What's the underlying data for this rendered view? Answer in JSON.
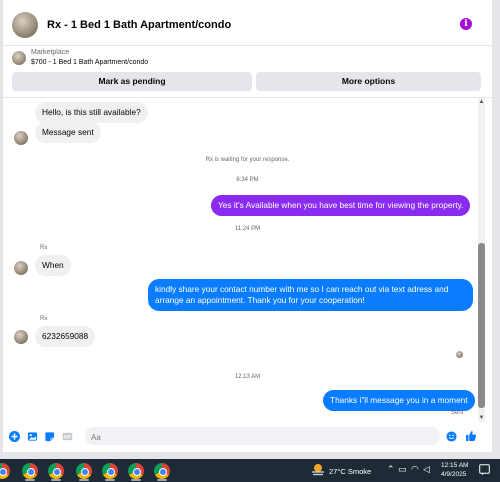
{
  "header": {
    "title": "Rx - 1 Bed 1 Bath Apartment/condo",
    "info_icon": "info-icon",
    "accent": "#a20dd9"
  },
  "marketplace": {
    "label": "Marketplace",
    "listing": "$700 - 1 Bed 1 Bath Apartment/condo",
    "mark_pending_label": "Mark as pending",
    "more_options_label": "More options"
  },
  "messages": {
    "m1": "Hello, is this still available?",
    "m2": "Message sent",
    "waiting": "Rx is waiting for your response.",
    "ts1": "6:34 PM",
    "m3": "Yes it's Available when you have best time for viewing the property.",
    "ts2": "11:24 PM",
    "sender1": "Rx",
    "m4": "When",
    "m5_line1": "kindly share your contact number with me so I can reach out via text adress and",
    "m5_line2": "arrange an appointment. Thank you for your cooperation!",
    "sender2": "Rx",
    "m6": "6232659088",
    "ts3": "12:13 AM",
    "m7": "Thanks i\"ll message you in a moment",
    "status": "Sent"
  },
  "composer": {
    "placeholder": "Aa",
    "icons": [
      "plus-icon",
      "image-icon",
      "sticker-icon",
      "gif-icon",
      "emoji-icon",
      "thumbs-up-icon"
    ]
  },
  "colors": {
    "outgoing": "#0a7cff",
    "outgoing_purple": "#8a2bf2",
    "incoming": "#f0f0f0",
    "taskbar": "#1e2a35"
  },
  "taskbar": {
    "weather": "27°C  Smoke",
    "time": "12:15 AM",
    "date": "4/9/2025",
    "app_icons": [
      "chrome-icon",
      "chrome-icon",
      "chrome-icon",
      "chrome-icon",
      "chrome-icon",
      "chrome-icon",
      "chrome-icon"
    ]
  }
}
